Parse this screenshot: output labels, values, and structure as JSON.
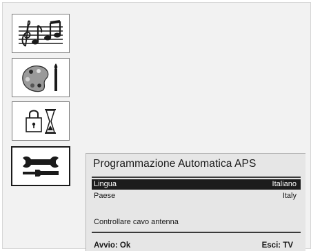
{
  "menu": {
    "icons": [
      {
        "name": "music-sound-icon"
      },
      {
        "name": "picture-palette-icon"
      },
      {
        "name": "timer-lock-icon"
      },
      {
        "name": "setup-tools-icon"
      }
    ],
    "selected_index": 3
  },
  "panel": {
    "title": "Programmazione Automatica APS",
    "rows": [
      {
        "label": "Lingua",
        "value": "Italiano",
        "selected": true
      },
      {
        "label": "Paese",
        "value": "Italy",
        "selected": false
      }
    ],
    "hint": "Controllare cavo antenna",
    "footer": {
      "left": "Avvio: Ok",
      "right": "Esci: TV"
    }
  },
  "colors": {
    "highlight": "#1c1c1c",
    "panel_bg": "#e6e6e6",
    "text": "#1a1a1a"
  }
}
